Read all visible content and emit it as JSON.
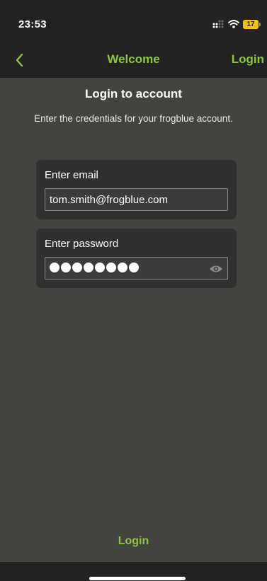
{
  "status_bar": {
    "time": "23:53",
    "battery_level": "17",
    "battery_color": "#f2c21b",
    "icons": [
      "signal-icon",
      "wifi-icon",
      "battery-icon"
    ]
  },
  "nav": {
    "back_icon": "chevron-left-icon",
    "title": "Welcome",
    "login_label": "Login",
    "accent_color": "#8cc63f"
  },
  "page": {
    "title": "Login to account",
    "subtitle": "Enter the credentials for your frogblue account."
  },
  "email": {
    "label": "Enter email",
    "value": "tom.smith@frogblue.com"
  },
  "password": {
    "label": "Enter password",
    "masked_length": 8,
    "toggle_icon": "eye-icon"
  },
  "footer": {
    "login_label": "Login"
  }
}
